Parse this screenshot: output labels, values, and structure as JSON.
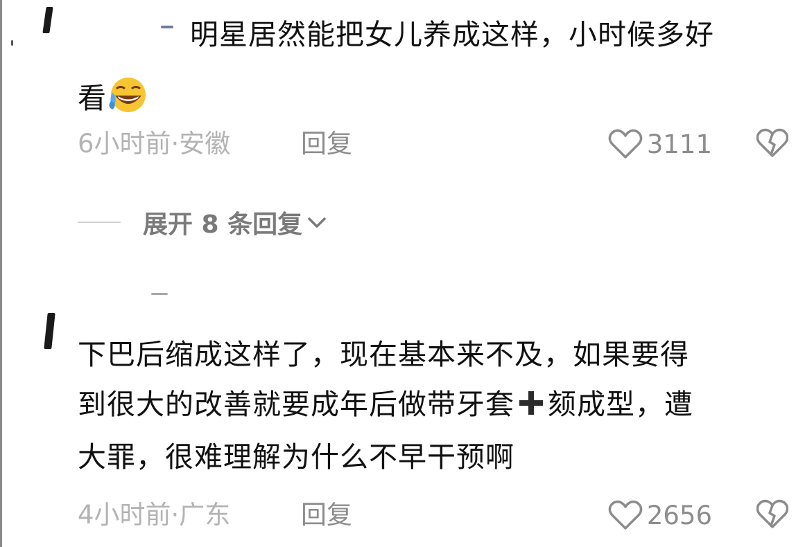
{
  "comments": [
    {
      "lines": [
        "明星居然能把女儿养成这样，小时候多好",
        "看"
      ],
      "emoji": "laughing-crying-emoji",
      "time_location": "6小时前·安徽",
      "reply_label": "回复",
      "likes": "3111"
    },
    {
      "lines": [
        "下巴后缩成这样了，现在基本来不及，如果要得",
        "到很大的改善就要成年后做带牙套",
        "颏成型，遭",
        "大罪，很难理解为什么不早干预啊"
      ],
      "time_location": "4小时前·广东",
      "reply_label": "回复",
      "likes": "2656"
    }
  ],
  "expand_replies": {
    "label": "展开 8 条回复"
  },
  "colors": {
    "text": "#111111",
    "meta": "#b3b3b3",
    "action": "#8c8c8c",
    "plus": "#2b2b2b"
  },
  "icons": [
    "heart-outline-icon",
    "broken-heart-icon",
    "chevron-down-icon",
    "plus-icon"
  ]
}
